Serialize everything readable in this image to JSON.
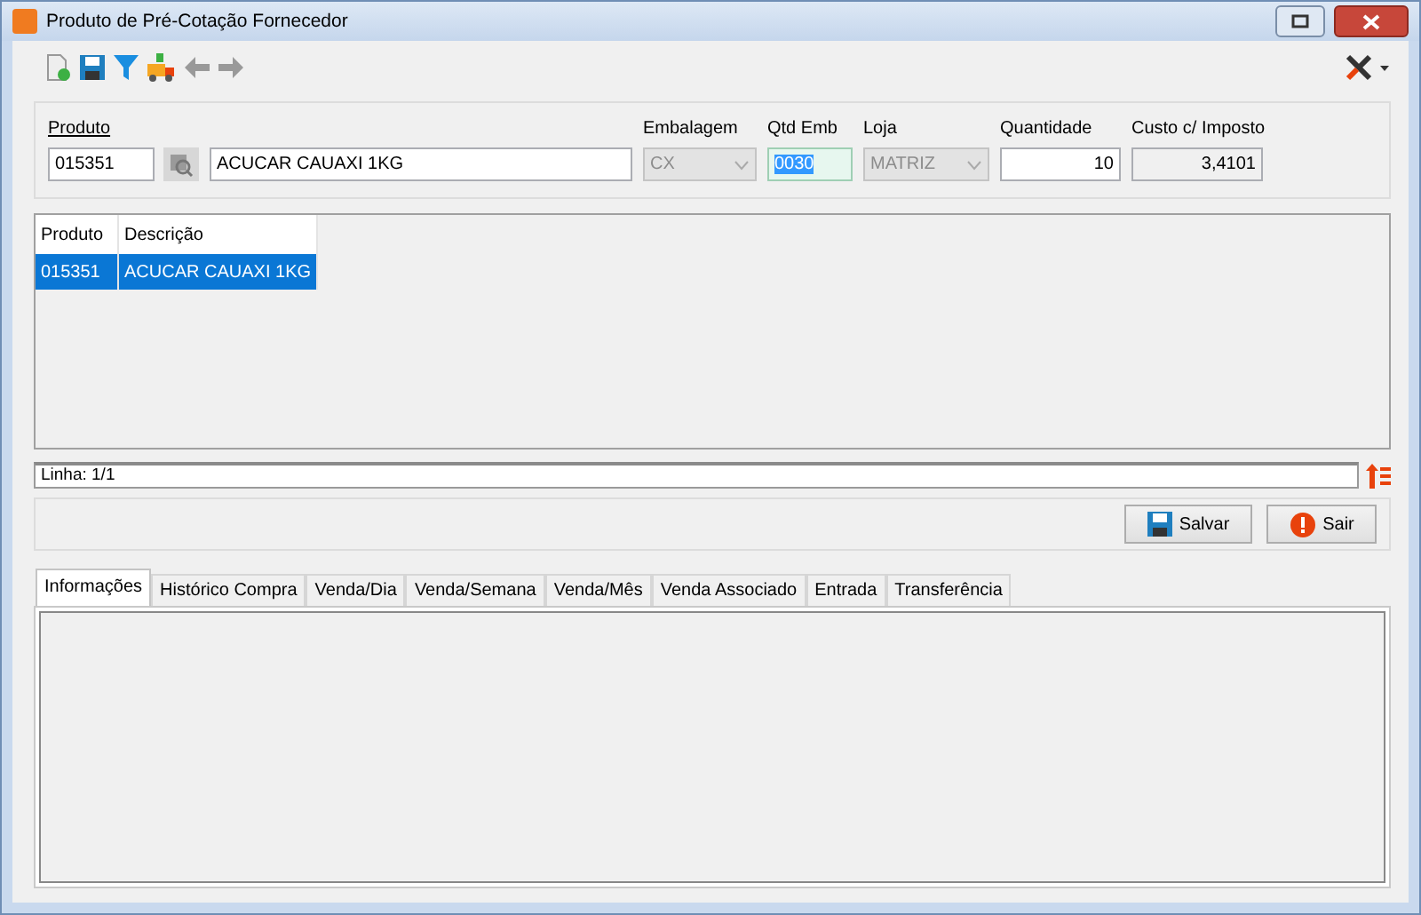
{
  "window": {
    "title": "Produto de Pré-Cotação Fornecedor"
  },
  "form": {
    "fields": [
      {
        "label": "Produto",
        "kind": "lookup",
        "value": "015351",
        "disabled": false,
        "underlined": true
      },
      {
        "kind": "text",
        "value": "ACUCAR CAUAXI 1KG",
        "disabled": false,
        "underlined": false
      },
      {
        "label": "Embalagem",
        "kind": "dropdown",
        "value": "CX",
        "disabled": true,
        "underlined": false
      },
      {
        "label": "Qtd Emb",
        "kind": "focused",
        "value": "0030",
        "disabled": false,
        "underlined": false
      },
      {
        "label": "Loja",
        "kind": "dropdown",
        "value": "MATRIZ",
        "disabled": true,
        "underlined": false
      },
      {
        "label": "Quantidade",
        "kind": "number",
        "value": "10",
        "disabled": false,
        "underlined": false
      },
      {
        "label": "Custo c/ Imposto",
        "kind": "readonly",
        "value": "3,4101",
        "disabled": false,
        "underlined": false
      }
    ]
  },
  "table": {
    "columns": [
      "Produto",
      "Descrição"
    ],
    "rows": [
      {
        "cells": [
          "015351",
          "ACUCAR CAUAXI 1KG"
        ],
        "selected": true
      }
    ]
  },
  "status_bar": {
    "text": "Linha: 1/1"
  },
  "buttons": [
    {
      "label": "Salvar",
      "kind": "save"
    },
    {
      "label": "Sair",
      "kind": "exit"
    }
  ],
  "tabs": [
    {
      "label": "Informações",
      "selected": true
    },
    {
      "label": "Histórico Compra",
      "selected": false
    },
    {
      "label": "Venda/Dia",
      "selected": false
    },
    {
      "label": "Venda/Semana",
      "selected": false
    },
    {
      "label": "Venda/Mês",
      "selected": false
    },
    {
      "label": "Venda Associado",
      "selected": false
    },
    {
      "label": "Entrada",
      "selected": false
    },
    {
      "label": "Transferência",
      "selected": false
    }
  ]
}
